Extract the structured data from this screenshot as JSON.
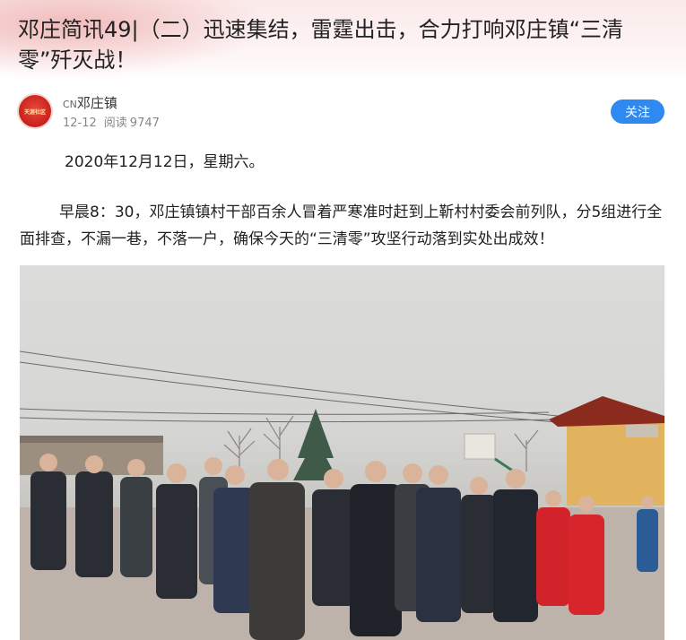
{
  "article": {
    "title": "邓庄简讯49|（二）迅速集结，雷霆出击，合力打响邓庄镇“三清零”歼灭战！"
  },
  "author": {
    "prefix": "CN",
    "name": "邓庄镇",
    "date": "12-12",
    "reads_label": "阅读",
    "reads": "9747",
    "follow_label": "关注",
    "avatar_text": "天涯社区"
  },
  "content": {
    "paragraph1": "2020年12月12日，星期六。",
    "paragraph2": "早晨8：30，邓庄镇镇村干部百余人冒着严寒准时赶到上靳村村委会前列队，分5组进行全面排查，不漏一巷，不落一户，确保今天的“三清零”攻坚行动落到实处出成效！"
  },
  "photo": {
    "description_icon": "group-photo-image"
  },
  "colors": {
    "accent": "#2e89f0",
    "avatar_red": "#c8201c",
    "header_tint": "#fbeaea"
  }
}
